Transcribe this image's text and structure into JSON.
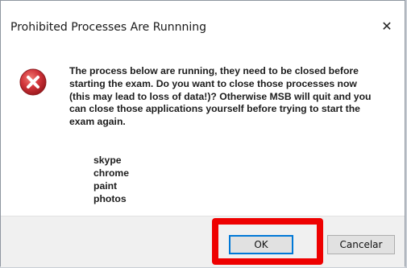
{
  "dialog": {
    "title": "Prohibited Processes Are Runnning",
    "close_glyph": "✕",
    "icon": "error-icon",
    "message": "The process below are running, they need to be closed before starting the exam. Do you want to close those processes now (this may lead to loss of data!)? Otherwise MSB will quit and you can close those applications yourself before trying to start the exam again.",
    "processes": [
      "skype",
      "chrome",
      "paint",
      "photos"
    ],
    "buttons": {
      "ok_label": "OK",
      "cancel_label": "Cancelar"
    }
  },
  "colors": {
    "error_red": "#c0252b",
    "highlight_red": "#ee0000",
    "focus_blue": "#0078d7",
    "footer_bg": "#f0f0f0"
  }
}
